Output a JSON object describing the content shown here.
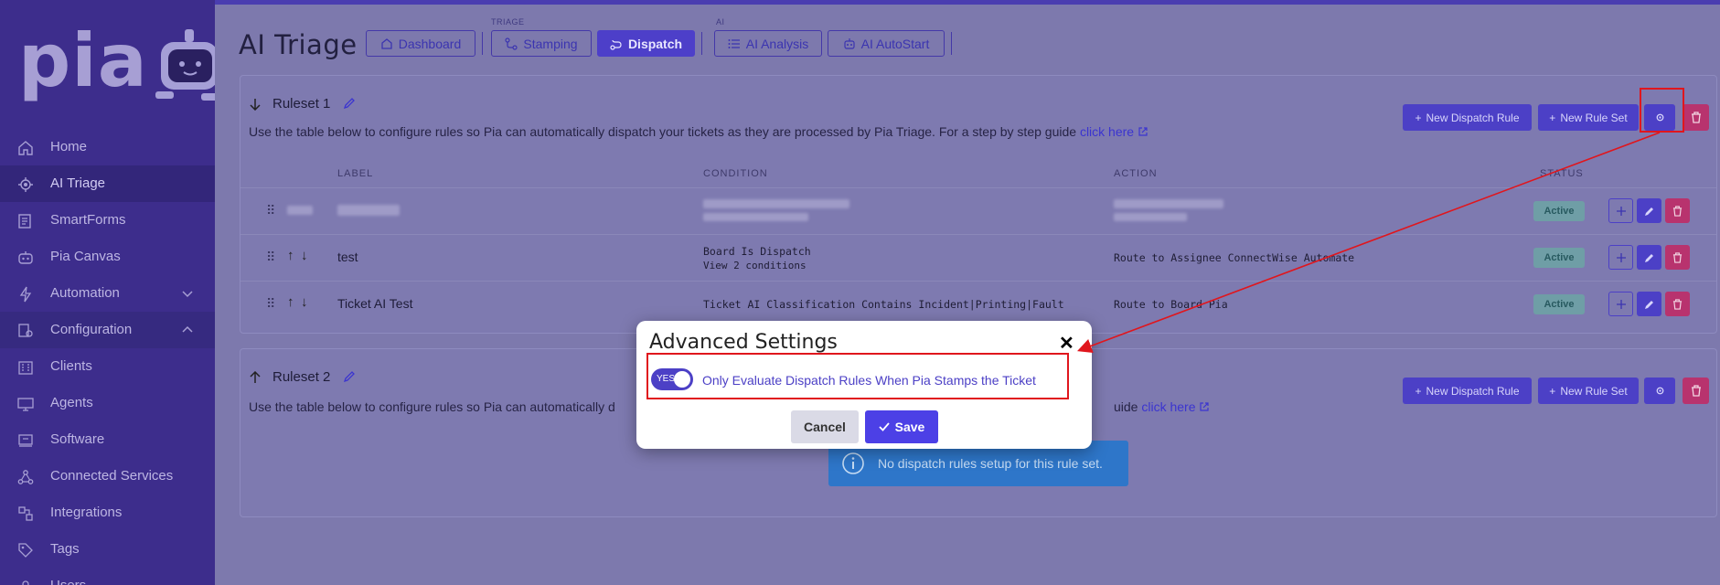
{
  "sidebar": {
    "logo_text": "pia",
    "items": [
      {
        "label": "Home",
        "icon": "home-icon"
      },
      {
        "label": "AI Triage",
        "icon": "triage-gear-icon",
        "active": true
      },
      {
        "label": "SmartForms",
        "icon": "smartforms-icon"
      },
      {
        "label": "Pia Canvas",
        "icon": "canvas-robot-icon"
      },
      {
        "label": "Automation",
        "icon": "lightning-icon",
        "chevron": "down"
      },
      {
        "label": "Configuration",
        "icon": "configuration-icon",
        "chevron": "up"
      },
      {
        "label": "Clients",
        "icon": "building-icon"
      },
      {
        "label": "Agents",
        "icon": "monitor-icon"
      },
      {
        "label": "Software",
        "icon": "software-icon"
      },
      {
        "label": "Connected Services",
        "icon": "network-icon"
      },
      {
        "label": "Integrations",
        "icon": "integrations-icon"
      },
      {
        "label": "Tags",
        "icon": "tag-icon"
      },
      {
        "label": "Users",
        "icon": "users-icon"
      }
    ]
  },
  "header": {
    "title": "AI Triage",
    "groups": {
      "triage": "TRIAGE",
      "ai": "AI"
    },
    "tabs": {
      "dashboard": "Dashboard",
      "stamping": "Stamping",
      "dispatch": "Dispatch",
      "ai_analysis": "AI Analysis",
      "ai_autostart": "AI AutoStart"
    }
  },
  "ruleset1": {
    "name": "Ruleset 1",
    "description": "Use the table below to configure rules so Pia can automatically dispatch your tickets as they are processed by Pia Triage. For a step by step guide",
    "link": "click here",
    "new_dispatch_rule": "New Dispatch Rule",
    "new_rule_set": "New Rule Set",
    "columns": {
      "label": "LABEL",
      "condition": "CONDITION",
      "action": "ACTION",
      "status": "STATUS"
    },
    "rows": [
      {
        "label": "",
        "condition": "",
        "condition_link": "",
        "action": "",
        "status": "Active",
        "blurred": true
      },
      {
        "label": "test",
        "condition": "Board Is Dispatch",
        "condition_link": "View 2 conditions",
        "action": "Route to Assignee ConnectWise Automate",
        "status": "Active"
      },
      {
        "label": "Ticket AI Test",
        "condition": "Ticket AI Classification Contains Incident|Printing|Fault",
        "condition_link": "",
        "action": "Route to Board Pia",
        "status": "Active"
      }
    ]
  },
  "ruleset2": {
    "name": "Ruleset 2",
    "description_left": "Use the table below to configure rules so Pia can automatically d",
    "description_right": "uide",
    "link": "click here",
    "new_dispatch_rule": "New Dispatch Rule",
    "new_rule_set": "New Rule Set",
    "empty_message": "No dispatch rules setup for this rule set."
  },
  "modal": {
    "title": "Advanced Settings",
    "toggle_text": "YES",
    "toggle_on": true,
    "toggle_label": "Only Evaluate Dispatch Rules When Pia Stamps the Ticket",
    "cancel": "Cancel",
    "save": "Save"
  },
  "colors": {
    "accent": "#4c40c6",
    "danger": "#b8336e",
    "annotation": "#e0161d"
  }
}
